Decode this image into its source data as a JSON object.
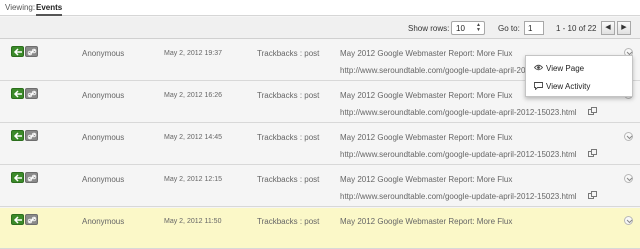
{
  "header": {
    "viewing_label": "Viewing:",
    "active_tab": "Events"
  },
  "toolbar": {
    "show_rows_label": "Show rows:",
    "show_rows_value": "10",
    "goto_label": "Go to:",
    "goto_value": "1",
    "range_text": "1 - 10 of 22"
  },
  "rows": [
    {
      "user": "Anonymous",
      "date": "May 2, 2012 19:37",
      "type": "Trackbacks : post",
      "title": "May 2012 Google Webmaster Report: More Flux",
      "url": "http://www.seroundtable.com/google-update-april-20"
    },
    {
      "user": "Anonymous",
      "date": "May 2, 2012 16:26",
      "type": "Trackbacks : post",
      "title": "May 2012 Google Webmaster Report: More Flux",
      "url": "http://www.seroundtable.com/google-update-april-2012-15023.html"
    },
    {
      "user": "Anonymous",
      "date": "May 2, 2012 14:45",
      "type": "Trackbacks : post",
      "title": "May 2012 Google Webmaster Report: More Flux",
      "url": "http://www.seroundtable.com/google-update-april-2012-15023.html"
    },
    {
      "user": "Anonymous",
      "date": "May 2, 2012 12:15",
      "type": "Trackbacks : post",
      "title": "May 2012 Google Webmaster Report: More Flux",
      "url": "http://www.seroundtable.com/google-update-april-2012-15023.html"
    },
    {
      "user": "Anonymous",
      "date": "May 2, 2012 11:50",
      "type": "Trackbacks : post",
      "title": "May 2012 Google Webmaster Report: More Flux",
      "url": ""
    }
  ],
  "context_menu": {
    "view_page": "View Page",
    "view_activity": "View Activity"
  },
  "colors": {
    "highlight_row": "#fbf8c8",
    "green_icon": "#3c8a2a"
  }
}
